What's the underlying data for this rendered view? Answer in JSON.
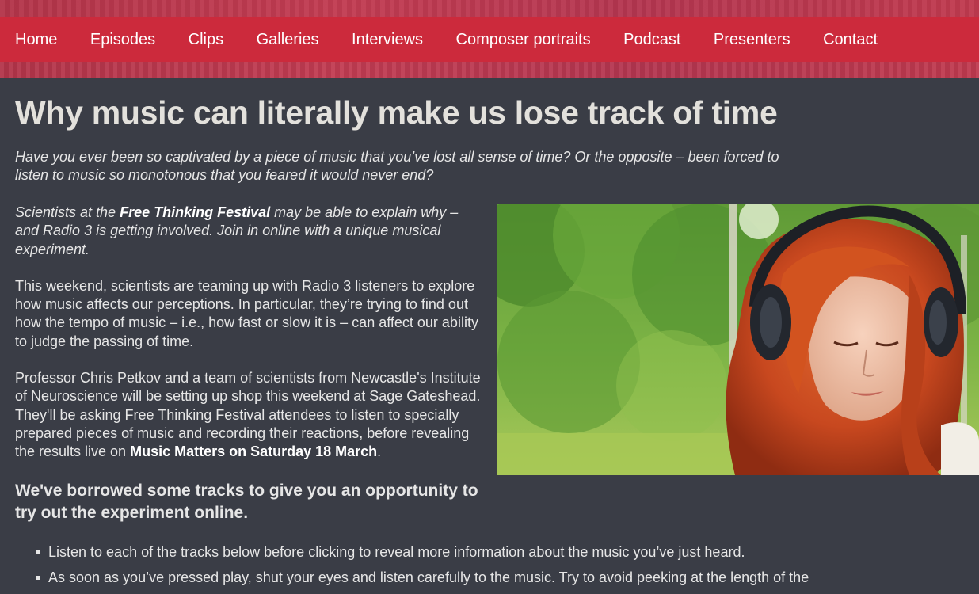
{
  "nav": {
    "items": [
      {
        "label": "Home"
      },
      {
        "label": "Episodes"
      },
      {
        "label": "Clips"
      },
      {
        "label": "Galleries"
      },
      {
        "label": "Interviews"
      },
      {
        "label": "Composer portraits"
      },
      {
        "label": "Podcast"
      },
      {
        "label": "Presenters"
      },
      {
        "label": "Contact"
      }
    ]
  },
  "article": {
    "title": "Why music can literally make us lose track of time",
    "intro": "Have you ever been so captivated by a piece of music that you’ve lost all sense of time? Or the opposite – been forced to listen to music so monotonous that you feared it would never end?",
    "lead": {
      "before": "Scientists at the ",
      "link": "Free Thinking Festival",
      "after": " may be able to explain why – and Radio 3 is getting involved. Join in online with a unique musical experiment."
    },
    "para1": "This weekend, scientists are teaming up with Radio 3 listeners to explore how music affects our perceptions. In particular, they’re trying to find out how the tempo of music – i.e., how fast or slow it is – can affect our ability to judge the passing of time.",
    "para2": {
      "before": "Professor Chris Petkov and a team of scientists from Newcastle's Institute of Neuroscience will be setting up shop this weekend at Sage Gateshead. They'll be asking Free Thinking Festival attendees to listen to specially prepared pieces of music and recording their reactions, before revealing the results live on ",
      "link": "Music Matters on Saturday 18 March",
      "after": "."
    },
    "subhead": "We've borrowed some tracks to give you an opportunity to try out the experiment online.",
    "instructions": [
      "Listen to each of the tracks below before clicking to reveal more information about the music you’ve just heard.",
      "As soon as you’ve pressed play, shut your eyes and listen carefully to the music. Try to avoid peeking at the length of the"
    ]
  },
  "colors": {
    "background": "#3a3d46",
    "nav_bar": "#cc2a3c",
    "top_band": "#b3354a",
    "title_text": "#e3e1dc",
    "body_text": "#e6e6e6"
  }
}
